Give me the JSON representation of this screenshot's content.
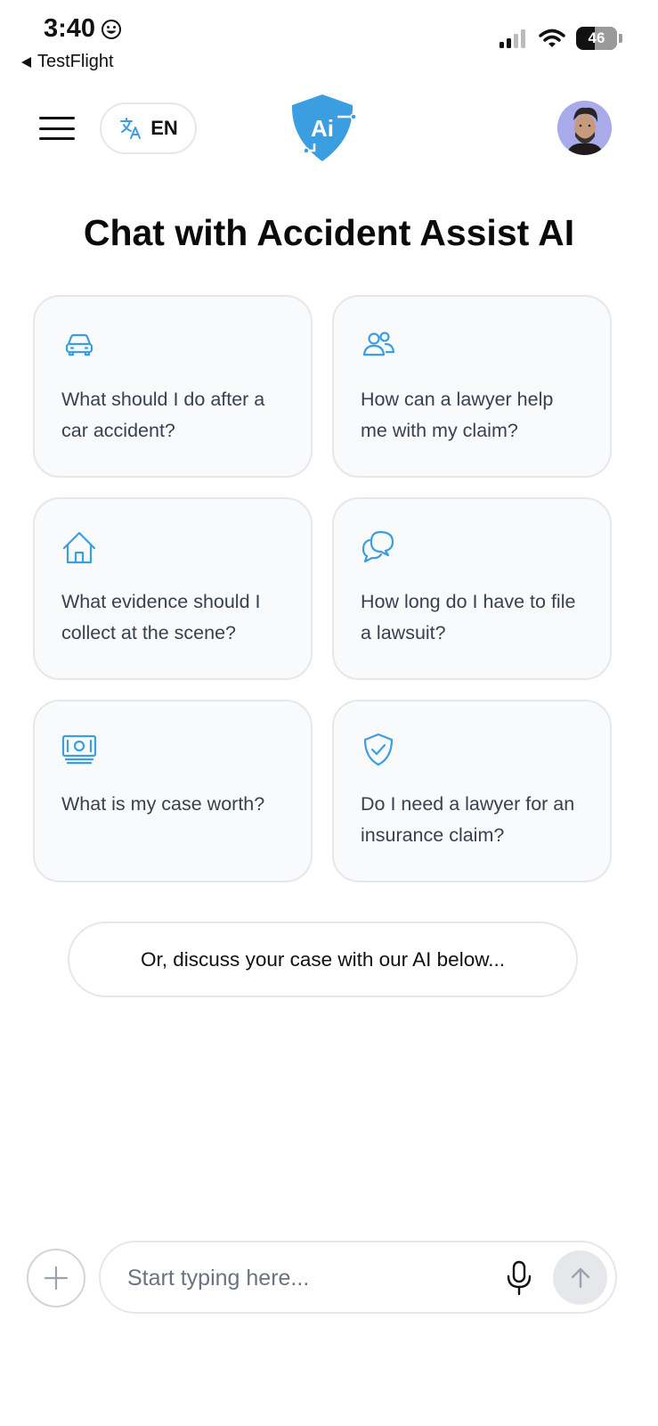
{
  "status_bar": {
    "time": "3:40",
    "back_app": "TestFlight",
    "battery": "46"
  },
  "header": {
    "language_code": "EN",
    "logo_text": "Ai",
    "brand_color": "#3b9ee0"
  },
  "page_title": "Chat with Accident Assist AI",
  "suggestions": [
    {
      "icon": "car-icon",
      "text": "What should I do after a car accident?"
    },
    {
      "icon": "users-icon",
      "text": "How can a lawyer help me with my claim?"
    },
    {
      "icon": "home-icon",
      "text": "What evidence should I collect at the scene?"
    },
    {
      "icon": "chat-bubbles-icon",
      "text": "How long do I have to file a lawsuit?"
    },
    {
      "icon": "banknote-icon",
      "text": "What is my case worth?"
    },
    {
      "icon": "shield-check-icon",
      "text": "Do I need a lawyer for an insurance claim?"
    }
  ],
  "discuss_text": "Or, discuss your case with our AI below...",
  "composer": {
    "placeholder": "Start typing here..."
  },
  "colors": {
    "icon_blue": "#3b9ee0",
    "card_bg": "#f9fafb",
    "card_border": "#e5e7eb"
  }
}
